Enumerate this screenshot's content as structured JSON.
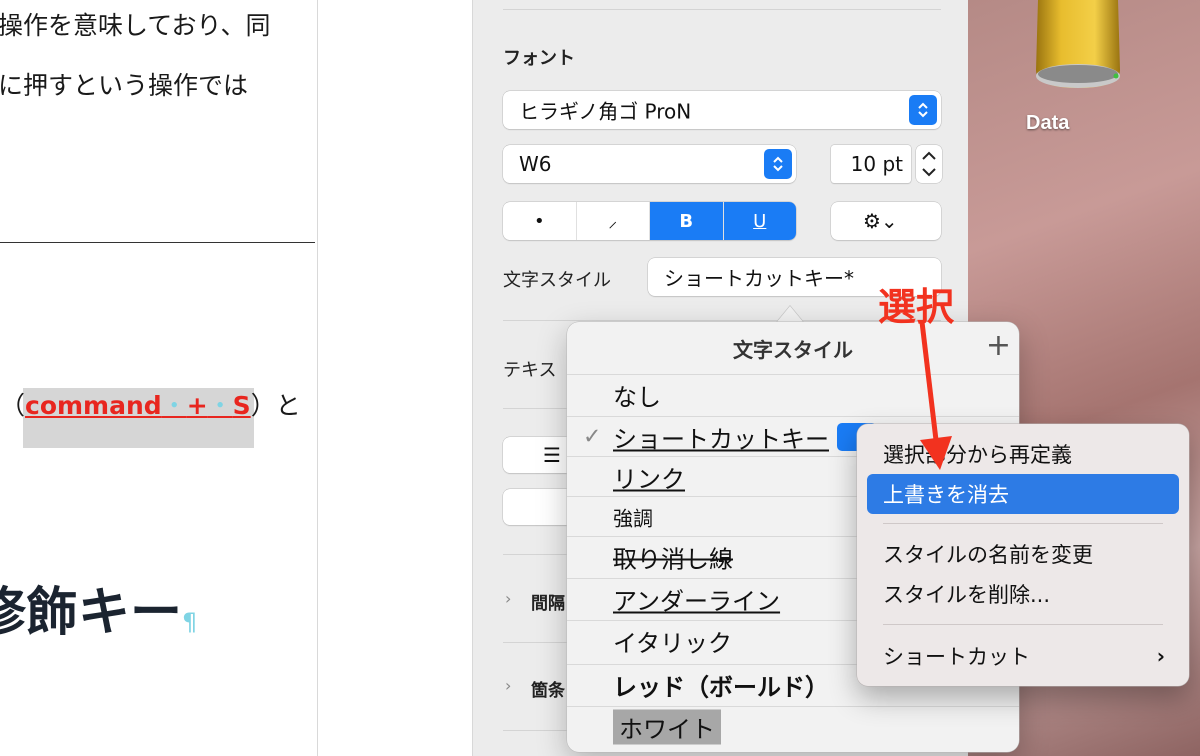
{
  "document": {
    "line1": "操作を意味しており、同",
    "line2": "に押すという操作では",
    "paren_open": "（",
    "cmd_word": "command",
    "cmd_dot": "・",
    "cmd_plus": "+",
    "cmd_s": "S",
    "paren_close": "）と",
    "heading": "修飾キー",
    "pilcrow": "¶"
  },
  "sidebar": {
    "font_section_label": "フォント",
    "font_family": "ヒラギノ角ゴ ProN",
    "font_weight": "W6",
    "font_size": "10 pt",
    "style_buttons": [
      "•",
      "⸝",
      "B",
      "U"
    ],
    "gear_label": "⚙︎⌄",
    "char_style_label": "文字スタイル",
    "char_style_value": "ショートカットキー*",
    "text_label": "テキス",
    "spacing_label": "間隔",
    "bullets_label": "箇条"
  },
  "desktop": {
    "drive_label": "Data"
  },
  "popover": {
    "title": "文字スタイル",
    "add_icon": "+",
    "items": [
      {
        "label": "なし"
      },
      {
        "label": "ショートカットキー",
        "checked": "✓"
      },
      {
        "label": "リンク"
      },
      {
        "label": "強調"
      },
      {
        "label": "取り消し線"
      },
      {
        "label": "アンダーライン"
      },
      {
        "label": "イタリック"
      },
      {
        "label": "レッド（ボールド）"
      },
      {
        "label": "ホワイト"
      }
    ]
  },
  "context_menu": {
    "items": [
      {
        "label": "選択部分から再定義"
      },
      {
        "label": "上書きを消去"
      },
      {
        "label": "スタイルの名前を変更"
      },
      {
        "label": "スタイルを削除..."
      },
      {
        "label": "ショートカット"
      }
    ],
    "submenu_arrow": "›"
  },
  "annotation": {
    "text": "選択",
    "color": "#f2321f"
  },
  "colors": {
    "accent": "#1a7cf5",
    "menu_highlight": "#2d7be5",
    "red_text": "#e8261f"
  }
}
